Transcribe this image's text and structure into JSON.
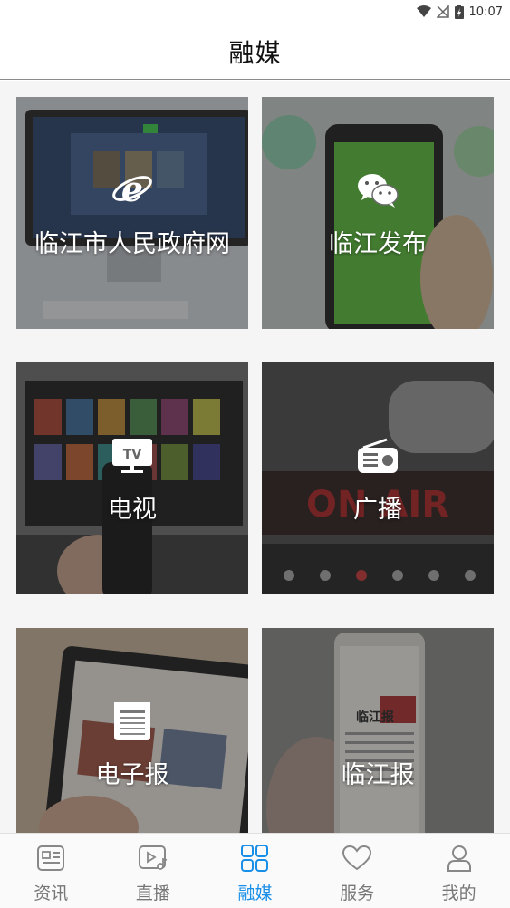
{
  "status_bar": {
    "time": "10:07"
  },
  "header": {
    "title": "融媒"
  },
  "tiles": [
    {
      "label": "临江市人民政府网",
      "icon": "internet-explorer-icon"
    },
    {
      "label": "临江发布",
      "icon": "wechat-icon"
    },
    {
      "label": "电视",
      "icon": "tv-icon"
    },
    {
      "label": "广播",
      "icon": "radio-icon"
    },
    {
      "label": "电子报",
      "icon": "newspaper-icon"
    },
    {
      "label": "临江报",
      "icon": "newspaper-phone-image"
    }
  ],
  "tile_overlay_texts": {
    "newspaper_masthead": "临江报"
  },
  "tab_bar": {
    "tabs": [
      {
        "label": "资讯",
        "icon": "news-icon",
        "active": false
      },
      {
        "label": "直播",
        "icon": "live-video-icon",
        "active": false
      },
      {
        "label": "融媒",
        "icon": "grid-icon",
        "active": true
      },
      {
        "label": "服务",
        "icon": "heart-icon",
        "active": false
      },
      {
        "label": "我的",
        "icon": "user-icon",
        "active": false
      }
    ]
  },
  "colors": {
    "accent": "#1a8fe8",
    "inactive": "#777777",
    "tile_overlay": "rgba(40,40,40,0.45)"
  }
}
